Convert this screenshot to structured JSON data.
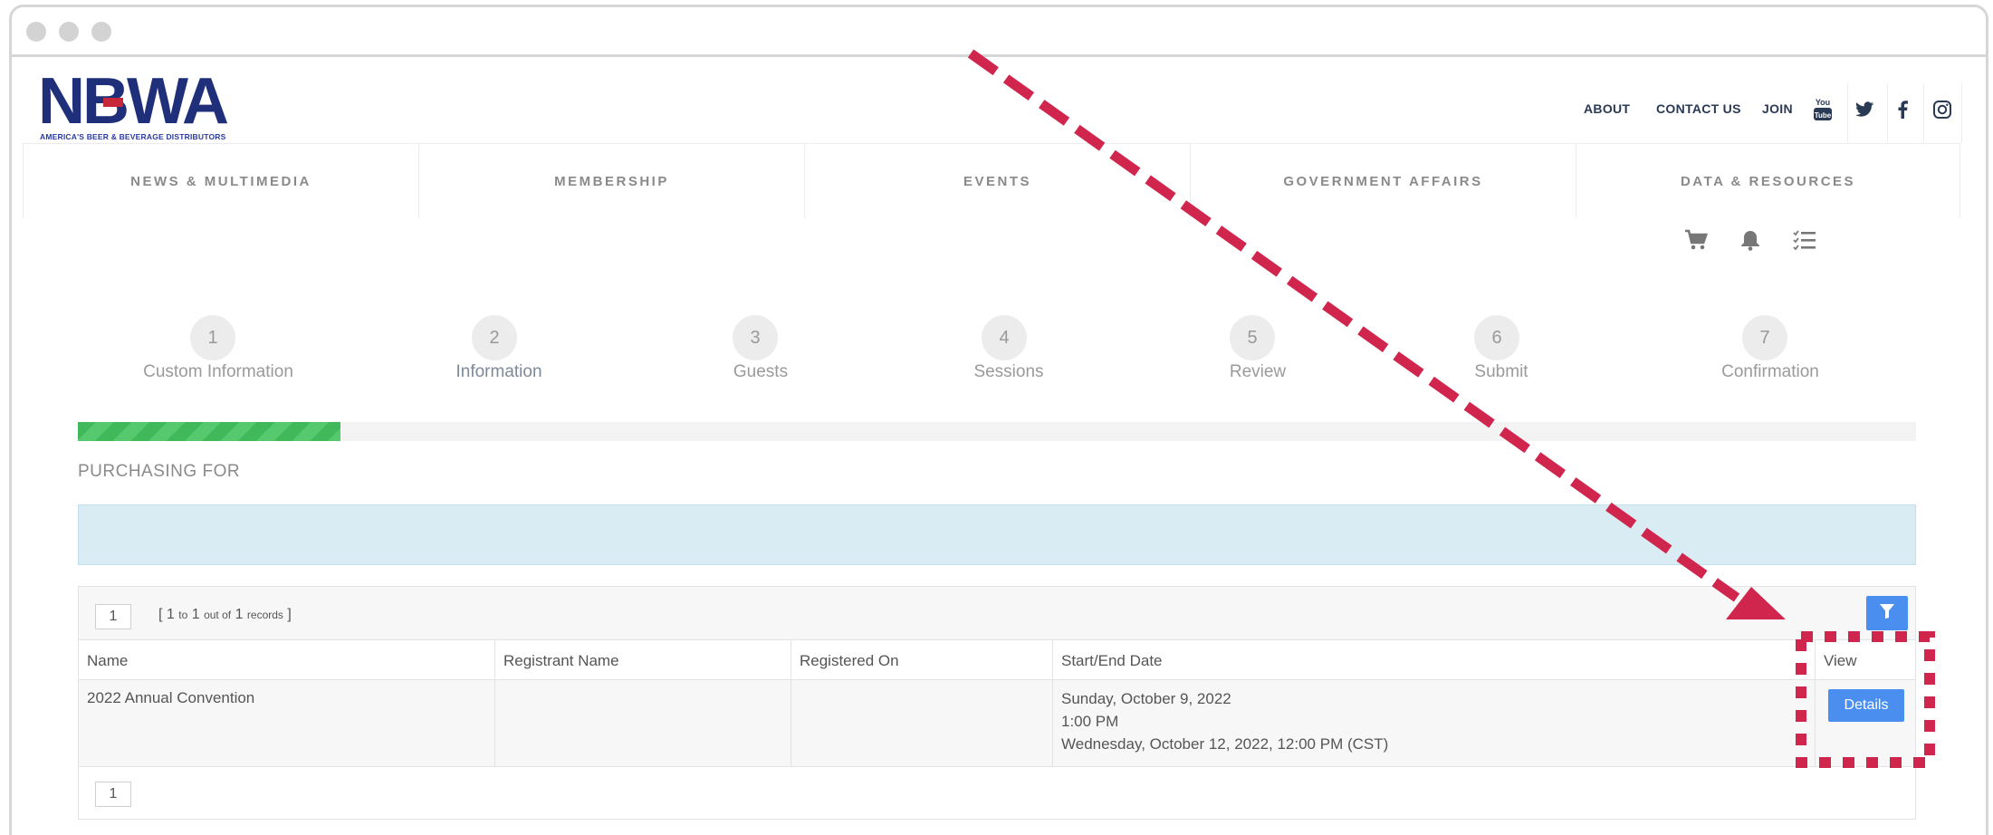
{
  "window": {
    "controls": [
      "close",
      "minimize",
      "maximize"
    ]
  },
  "brand": {
    "logo_text": "NBWA",
    "tagline": "AMERICA'S BEER & BEVERAGE DISTRIBUTORS",
    "logo_color": "#1f2f7a",
    "accent": "#c6283a"
  },
  "top_links": {
    "about": "ABOUT",
    "contact": "CONTACT US",
    "join": "JOIN"
  },
  "social_icons": [
    "youtube-icon",
    "twitter-icon",
    "facebook-icon",
    "instagram-icon"
  ],
  "social_glyphs": {
    "youtube": "You Tube",
    "twitter": "🐦",
    "facebook": "f",
    "instagram": "◎"
  },
  "main_nav": [
    "NEWS & MULTIMEDIA",
    "MEMBERSHIP",
    "EVENTS",
    "GOVERNMENT AFFAIRS",
    "DATA & RESOURCES"
  ],
  "utility_icons": [
    "cart-icon",
    "bell-icon",
    "checklist-icon"
  ],
  "steps": [
    {
      "number": "1",
      "label": "Custom Information"
    },
    {
      "number": "2",
      "label": "Information",
      "active": true
    },
    {
      "number": "3",
      "label": "Guests"
    },
    {
      "number": "4",
      "label": "Sessions"
    },
    {
      "number": "5",
      "label": "Review"
    },
    {
      "number": "6",
      "label": "Submit"
    },
    {
      "number": "7",
      "label": "Confirmation"
    }
  ],
  "progress": {
    "fraction": 0.143,
    "color": "#3fb95a"
  },
  "purchasing_for": "PURCHASING FOR",
  "table": {
    "pager": {
      "page": "1",
      "range_prefix": "[ ",
      "from": "1",
      "to_word": "to",
      "to": "1",
      "out_of": "out of",
      "total": "1",
      "records_word": "records",
      "range_suffix": " ]"
    },
    "columns": [
      "Name",
      "Registrant Name",
      "Registered On",
      "Start/End Date",
      "View"
    ],
    "rows": [
      {
        "name": "2022 Annual Convention",
        "registrant_name": "",
        "registered_on": "",
        "start_end_date": [
          "Sunday, October 9, 2022",
          "1:00 PM",
          "Wednesday, October 12, 2022, 12:00 PM (CST)"
        ],
        "view_button": "Details"
      }
    ],
    "footer_page": "1"
  },
  "colors": {
    "button": "#4a8ff0",
    "annotation": "#d0264e",
    "info_box": "#d9ecf4"
  }
}
